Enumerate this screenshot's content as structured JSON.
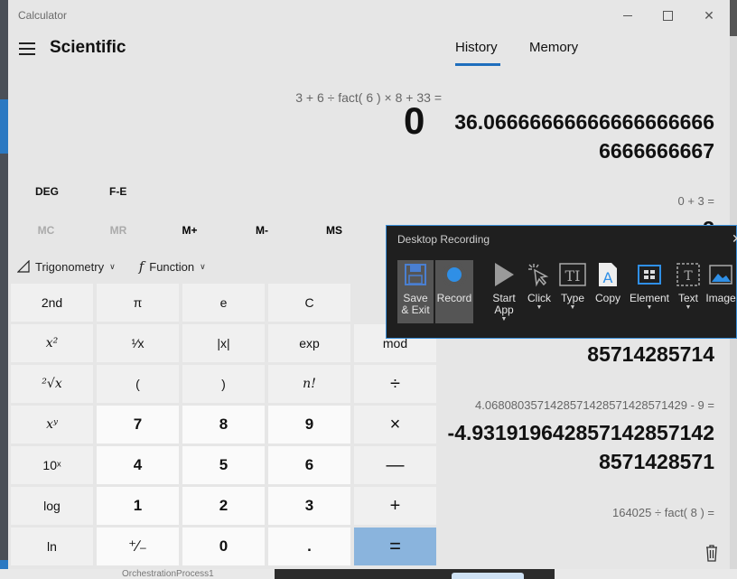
{
  "window": {
    "title": "Calculator"
  },
  "header": {
    "mode": "Scientific"
  },
  "display": {
    "expression": "3  +  6  ÷  fact( 6 )  ×  8  +  33 =",
    "value": "0"
  },
  "modes": {
    "angle": "DEG",
    "fe": "F-E"
  },
  "memory": {
    "mc": "MC",
    "mr": "MR",
    "mplus": "M+",
    "mminus": "M-",
    "ms": "MS"
  },
  "functions": {
    "trig": "Trigonometry",
    "func": "Function"
  },
  "keys": {
    "row1": [
      "2nd",
      "π",
      "e",
      "C",
      ""
    ],
    "row2": [
      "x²",
      "¹⁄x",
      "|x|",
      "exp",
      "mod"
    ],
    "row3": [
      "²√x",
      "(",
      ")",
      "n!",
      "÷"
    ],
    "row4": [
      "xʸ",
      "7",
      "8",
      "9",
      "×"
    ],
    "row5": [
      "10ˣ",
      "4",
      "5",
      "6",
      "—"
    ],
    "row6": [
      "log",
      "1",
      "2",
      "3",
      "+"
    ],
    "row7": [
      "ln",
      "⁺∕₋",
      "0",
      ".",
      "="
    ]
  },
  "history_panel": {
    "tabs": [
      "History",
      "Memory"
    ],
    "active_tab": "History",
    "entries": [
      {
        "expr": "",
        "result_line1": "36.06666666666666666666",
        "result_line2": "6666666667"
      },
      {
        "expr": "0  +  3 =",
        "result_line1": "3",
        "result_line2": ""
      },
      {
        "expr": "",
        "result_line1": "",
        "result_line2": "85714285714"
      },
      {
        "expr": "4.0680803571428571428571428571429   -   9 =",
        "result_line1": "-4.93191964285714285714​2",
        "result_line2": "8571428571"
      },
      {
        "expr": "164025   ÷   fact( 8 ) =",
        "result_line1": "",
        "result_line2": ""
      }
    ]
  },
  "recording": {
    "title": "Desktop Recording",
    "tools": [
      {
        "label": "Save\n& Exit",
        "icon": "save-icon"
      },
      {
        "label": "Record",
        "icon": "record-icon"
      },
      {
        "label": "Start\nApp",
        "icon": "start-app-icon"
      },
      {
        "label": "Click",
        "icon": "click-icon"
      },
      {
        "label": "Type",
        "icon": "type-icon"
      },
      {
        "label": "Copy",
        "icon": "copy-icon"
      },
      {
        "label": "Element",
        "icon": "element-icon"
      },
      {
        "label": "Text",
        "icon": "text-icon"
      },
      {
        "label": "Image",
        "icon": "image-icon"
      }
    ]
  },
  "taskbar": {
    "item": "OrchestrationProcess1"
  },
  "colors": {
    "accent": "#1e6ebd",
    "equals": "#8ab4dd",
    "overlay": "#1f1f1f"
  }
}
